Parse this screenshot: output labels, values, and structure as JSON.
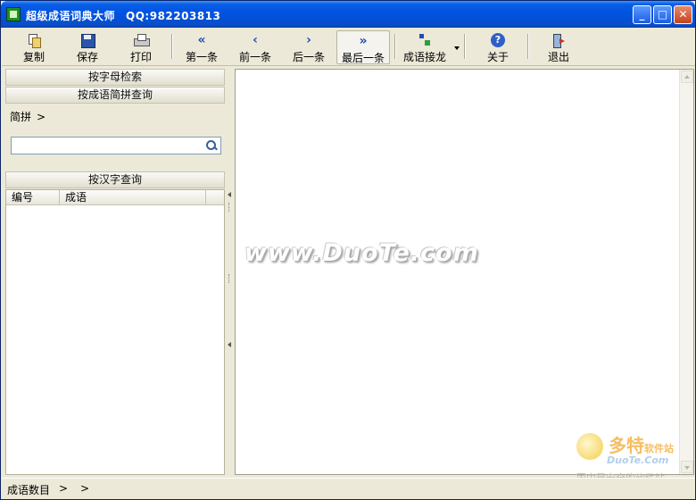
{
  "window": {
    "title": "超级成语词典大师",
    "qq": "QQ:982203813",
    "minimize": "_",
    "maximize": "□",
    "close": "✕"
  },
  "toolbar": {
    "copy": "复制",
    "save": "保存",
    "print": "打印",
    "first": "第一条",
    "prev": "前一条",
    "next": "后一条",
    "last": "最后一条",
    "chain": "成语接龙",
    "about": "关于",
    "exit": "退出",
    "first_icon": "«",
    "prev_icon": "‹",
    "next_icon": "›",
    "last_icon": "»",
    "about_icon": "?"
  },
  "left": {
    "by_letter": "按字母检索",
    "by_pinyin": "按成语简拼查询",
    "jianpin_label": "简拼",
    "jianpin_chevron": ">",
    "search_placeholder": "",
    "by_hanzi": "按汉字查询",
    "columns": [
      "编号",
      "成语"
    ]
  },
  "right": {
    "watermark": "www.DuoTe.com"
  },
  "brand": {
    "name": "多特",
    "suffix": "软件站",
    "url": "DuoTe.Com",
    "slogan": "国内最安全的软件站"
  },
  "status": {
    "label": "成语数目",
    "chevron1": ">",
    "chevron2": ">"
  },
  "colors": {
    "titlebar": "#0054e3",
    "face": "#ece9d8",
    "toolbar_icon": "#1d4fb6"
  }
}
